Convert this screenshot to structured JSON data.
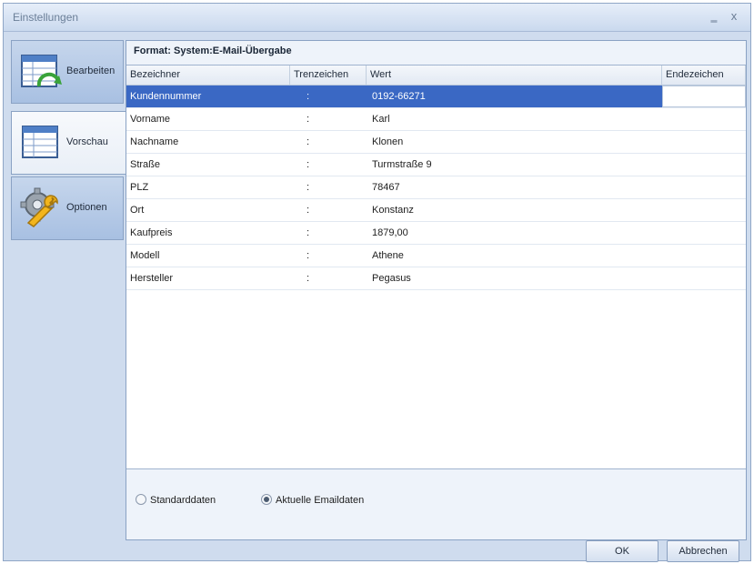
{
  "window": {
    "title": "Einstellungen",
    "pin_glyph": "‗",
    "close_glyph": "x"
  },
  "sidebar": {
    "items": [
      {
        "label": "Bearbeiten",
        "icon": "edit-table-icon"
      },
      {
        "label": "Vorschau",
        "icon": "table-preview-icon"
      },
      {
        "label": "Optionen",
        "icon": "gear-wrench-icon"
      }
    ],
    "active": "Vorschau"
  },
  "main": {
    "format_label": "Format:  System:E-Mail-Übergabe",
    "columns": [
      "Bezeichner",
      "Trenzeichen",
      "Wert",
      "Endezeichen"
    ],
    "rows": [
      {
        "name": "Kundennummer",
        "sep": ":",
        "value": "0192-66271",
        "end": ""
      },
      {
        "name": "Vorname",
        "sep": ":",
        "value": "Karl",
        "end": ""
      },
      {
        "name": "Nachname",
        "sep": ":",
        "value": "Klonen",
        "end": ""
      },
      {
        "name": "Straße",
        "sep": ":",
        "value": "Turmstraße 9",
        "end": ""
      },
      {
        "name": "PLZ",
        "sep": ":",
        "value": "78467",
        "end": ""
      },
      {
        "name": "Ort",
        "sep": ":",
        "value": "Konstanz",
        "end": ""
      },
      {
        "name": "Kaufpreis",
        "sep": ":",
        "value": "1879,00",
        "end": ""
      },
      {
        "name": "Modell",
        "sep": ":",
        "value": "Athene",
        "end": ""
      },
      {
        "name": "Hersteller",
        "sep": ":",
        "value": "Pegasus",
        "end": ""
      }
    ],
    "selected_row": 0
  },
  "radios": {
    "standard_label": "Standarddaten",
    "current_label": "Aktuelle Emaildaten",
    "selected": "current"
  },
  "buttons": {
    "ok": "OK",
    "cancel": "Abbrechen"
  },
  "colors": {
    "selection": "#3a68c4",
    "window_bg": "#cfdcee"
  }
}
